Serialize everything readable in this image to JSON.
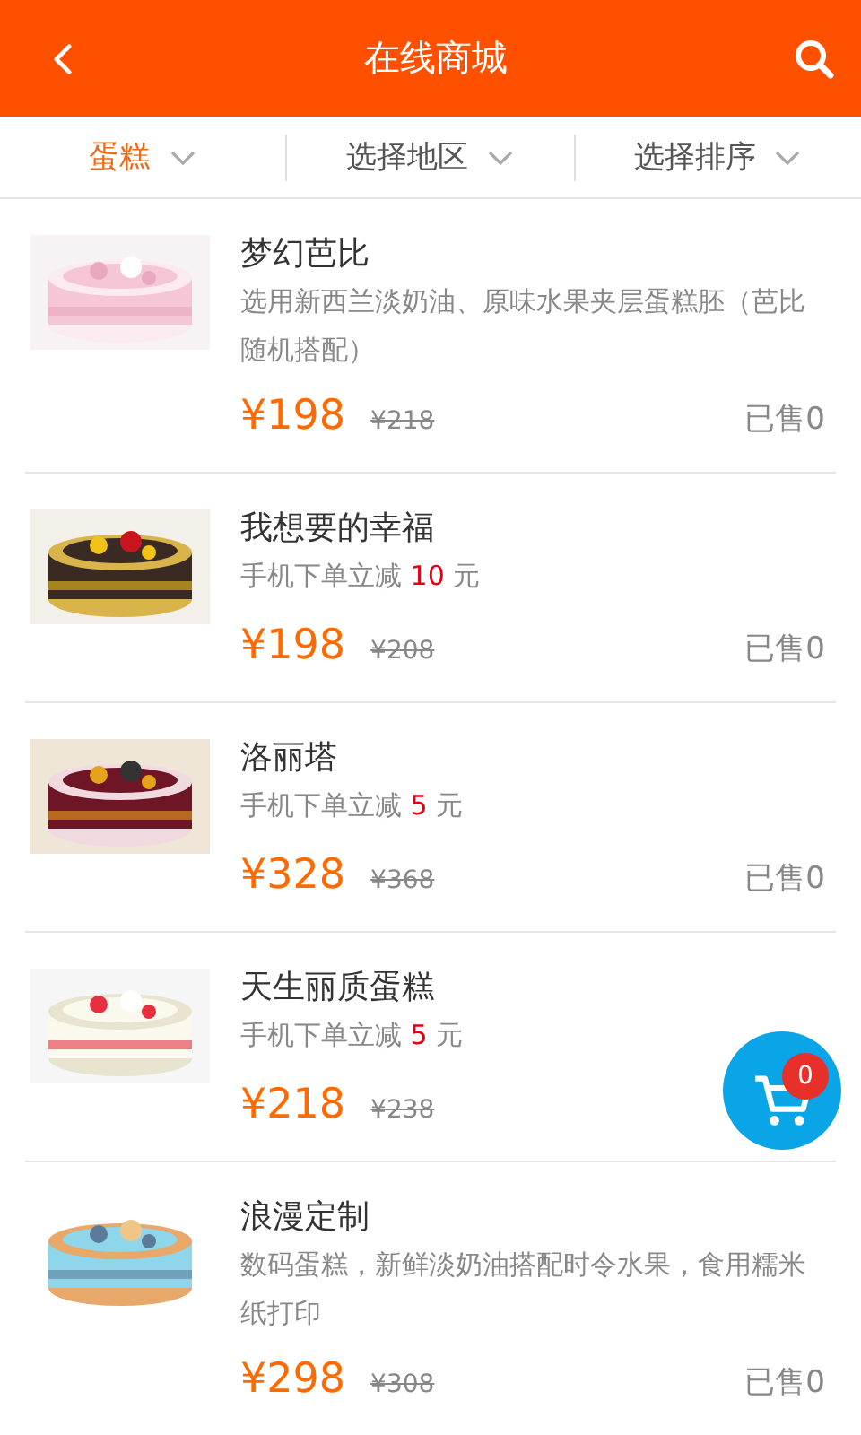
{
  "header": {
    "title": "在线商城"
  },
  "filters": [
    {
      "label": "蛋糕",
      "selected": true
    },
    {
      "label": "选择地区",
      "selected": false
    },
    {
      "label": "选择排序",
      "selected": false
    }
  ],
  "products": [
    {
      "title": "梦幻芭比",
      "kind": "text",
      "description": "选用新西兰淡奶油、原味水果夹层蛋糕胚（芭比随机搭配）",
      "price": "¥198",
      "old_price": "¥218",
      "sold": "已售0"
    },
    {
      "title": "我想要的幸福",
      "kind": "discount",
      "discount": {
        "before": "手机下单立减",
        "amount": "10",
        "after": "元"
      },
      "price": "¥198",
      "old_price": "¥208",
      "sold": "已售0"
    },
    {
      "title": "洛丽塔",
      "kind": "discount",
      "discount": {
        "before": "手机下单立减",
        "amount": "5",
        "after": "元"
      },
      "price": "¥328",
      "old_price": "¥368",
      "sold": "已售0"
    },
    {
      "title": "天生丽质蛋糕",
      "kind": "discount",
      "discount": {
        "before": "手机下单立减",
        "amount": "5",
        "after": "元"
      },
      "price": "¥218",
      "old_price": "¥238"
    },
    {
      "title": "浪漫定制",
      "kind": "text",
      "description": "数码蛋糕，新鲜淡奶油搭配时令水果，食用糯米纸打印",
      "price": "¥298",
      "old_price": "¥308",
      "sold": "已售0"
    }
  ],
  "cart": {
    "count": "0"
  }
}
